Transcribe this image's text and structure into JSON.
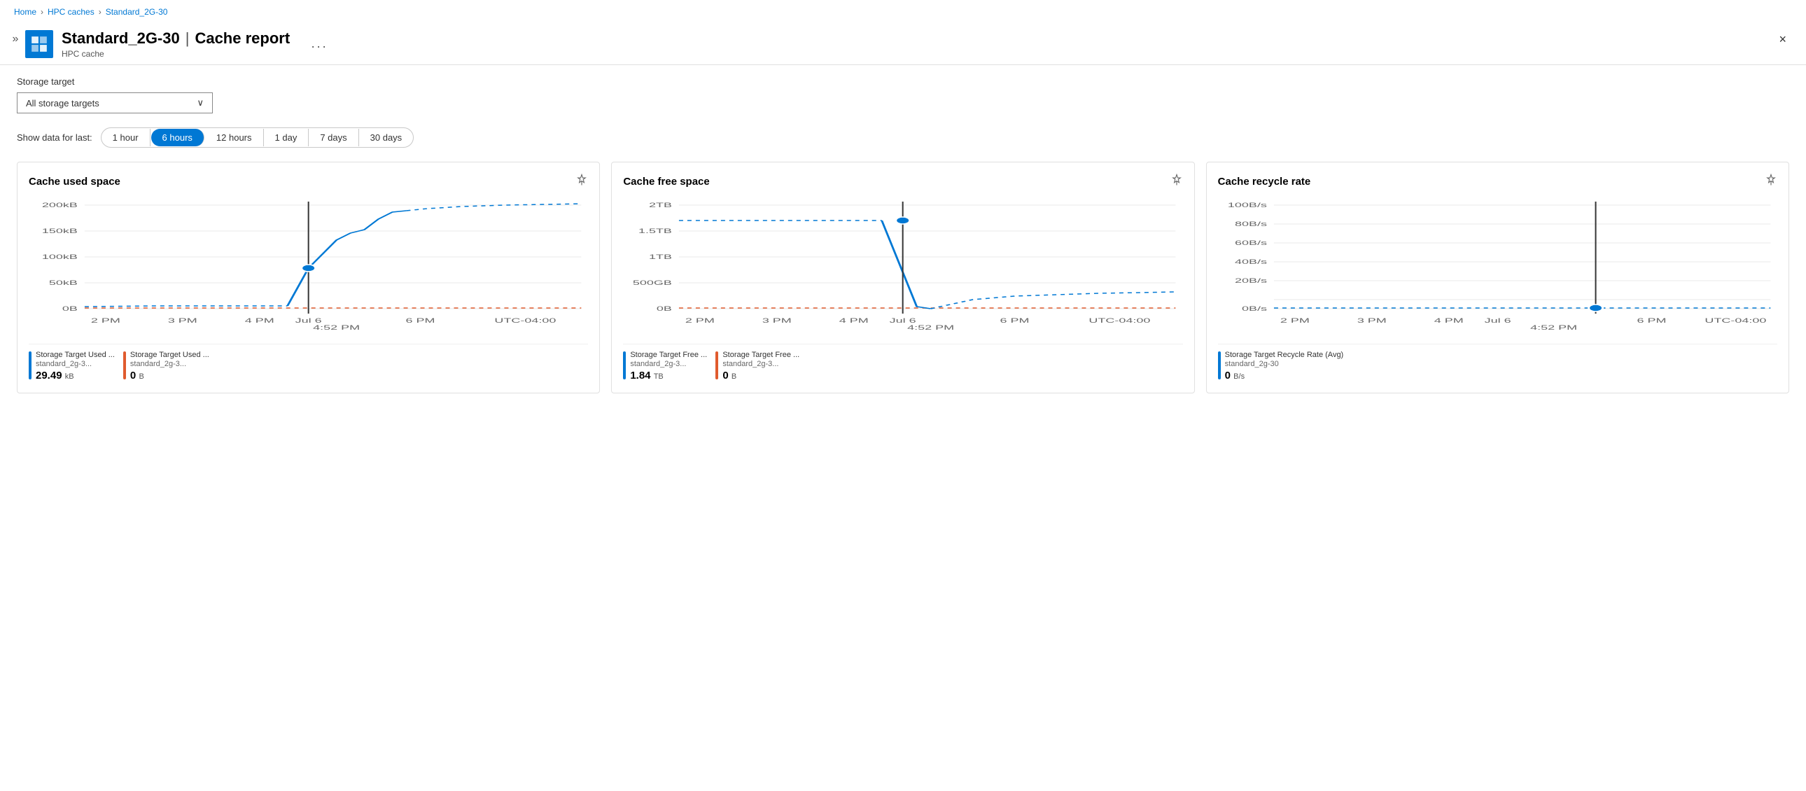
{
  "breadcrumb": {
    "home": "Home",
    "hpc_caches": "HPC caches",
    "current": "Standard_2G-30",
    "separator": ">"
  },
  "header": {
    "title": "Standard_2G-30",
    "separator": "|",
    "subtitle_page": "Cache report",
    "subtitle_type": "HPC cache",
    "more_label": "···",
    "close_label": "×"
  },
  "filter": {
    "label": "Storage target",
    "value": "All storage targets",
    "chevron": "⌄"
  },
  "time_filter": {
    "label": "Show data for last:",
    "options": [
      "1 hour",
      "6 hours",
      "12 hours",
      "1 day",
      "7 days",
      "30 days"
    ],
    "active": "6 hours"
  },
  "charts": [
    {
      "id": "used_space",
      "title": "Cache used space",
      "y_labels": [
        "200kB",
        "150kB",
        "100kB",
        "50kB",
        "0B"
      ],
      "x_labels": [
        "2 PM",
        "3 PM",
        "4 PM",
        "Jul 6",
        "4:52 PM",
        "6 PM",
        "UTC-04:00"
      ],
      "legend": [
        {
          "color": "#0078d4",
          "name": "Storage Target Used ...",
          "sub": "standard_2g-3...",
          "value": "29.49",
          "unit": "kB"
        },
        {
          "color": "#e05b2e",
          "name": "Storage Target Used ...",
          "sub": "standard_2g-3...",
          "value": "0",
          "unit": "B"
        }
      ]
    },
    {
      "id": "free_space",
      "title": "Cache free space",
      "y_labels": [
        "2TB",
        "1.5TB",
        "1TB",
        "500GB",
        "0B"
      ],
      "x_labels": [
        "2 PM",
        "3 PM",
        "4 PM",
        "Jul 6",
        "4:52 PM",
        "6 PM",
        "UTC-04:00"
      ],
      "legend": [
        {
          "color": "#0078d4",
          "name": "Storage Target Free ...",
          "sub": "standard_2g-3...",
          "value": "1.84",
          "unit": "TB"
        },
        {
          "color": "#e05b2e",
          "name": "Storage Target Free ...",
          "sub": "standard_2g-3...",
          "value": "0",
          "unit": "B"
        }
      ]
    },
    {
      "id": "recycle_rate",
      "title": "Cache recycle rate",
      "y_labels": [
        "100B/s",
        "80B/s",
        "60B/s",
        "40B/s",
        "20B/s",
        "0B/s"
      ],
      "x_labels": [
        "2 PM",
        "3 PM",
        "4 PM",
        "Jul 6",
        "4:52 PM",
        "6 PM",
        "UTC-04:00"
      ],
      "legend": [
        {
          "color": "#0078d4",
          "name": "Storage Target Recycle Rate (Avg)",
          "sub": "standard_2g-30",
          "value": "0",
          "unit": "B/s"
        }
      ]
    }
  ],
  "icons": {
    "pin": "📌",
    "chevron_right": ">",
    "collapse": "»"
  }
}
